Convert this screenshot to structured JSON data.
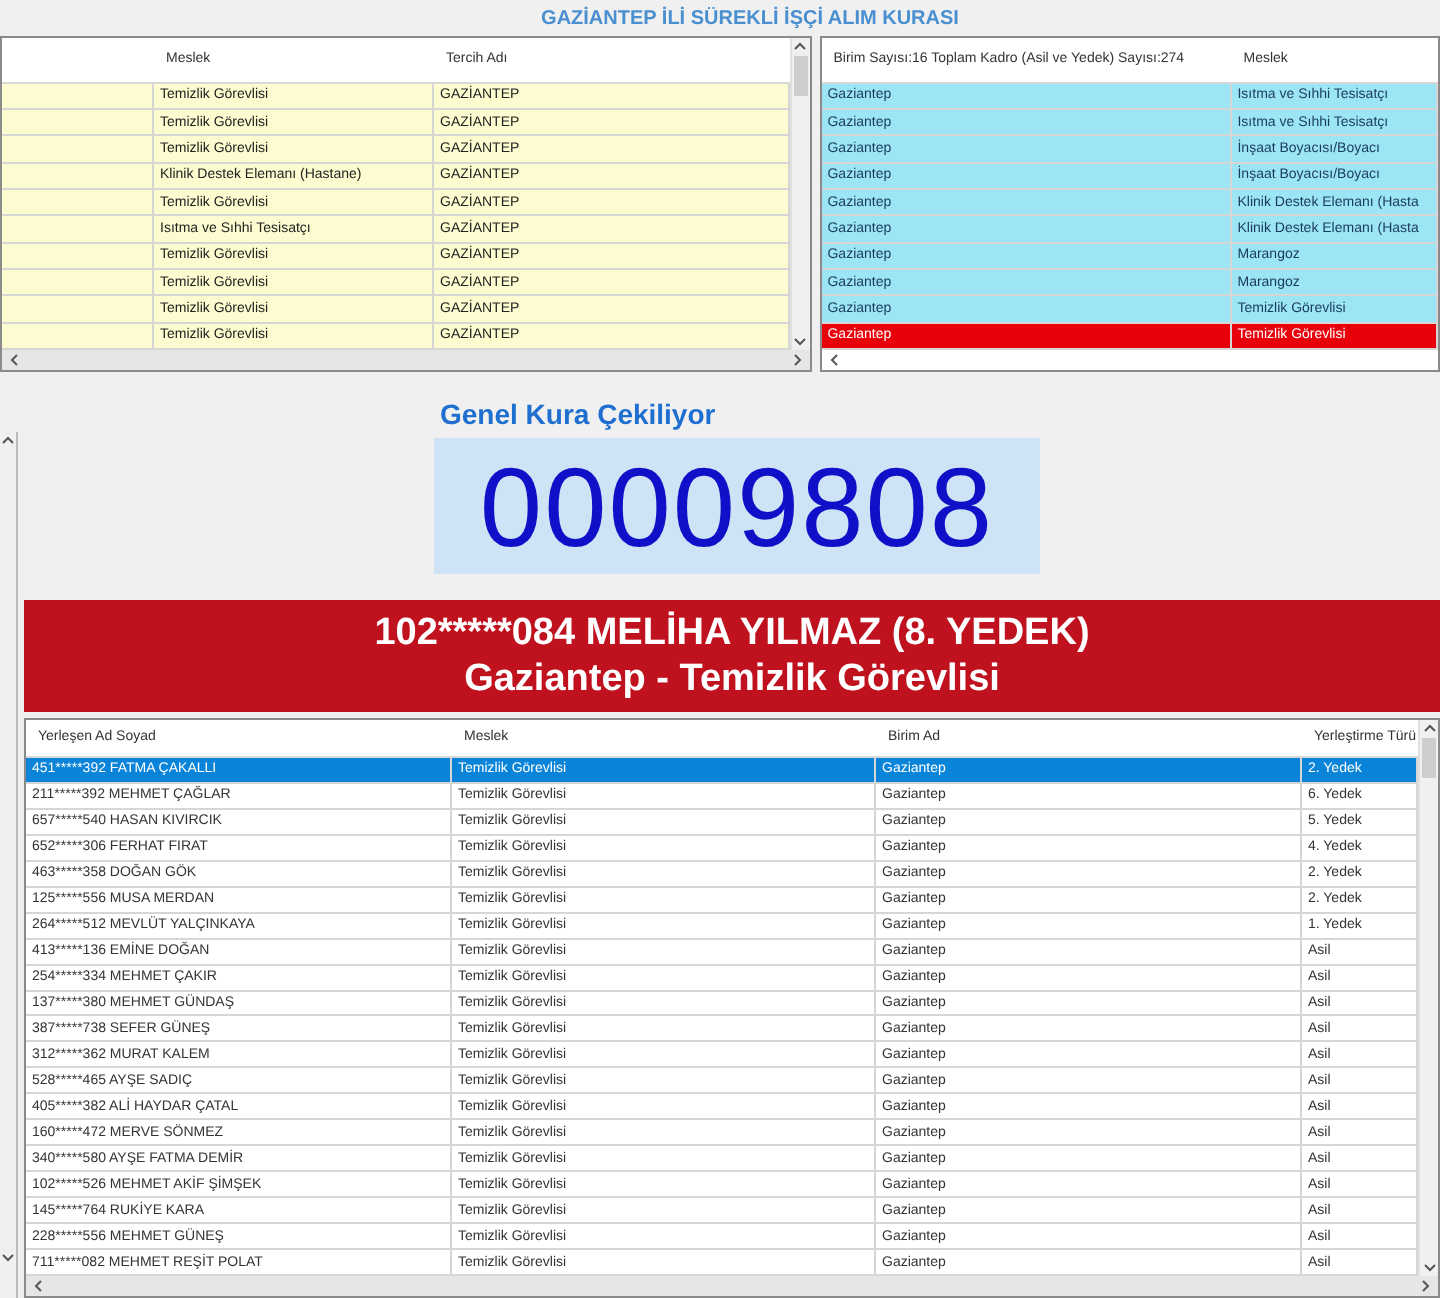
{
  "title": "GAZİANTEP İLİ SÜREKLİ İŞÇİ ALIM KURASI",
  "preferences_table": {
    "columns": [
      "Meslek",
      "Tercih Adı"
    ],
    "rows": [
      {
        "cells": [
          "Temizlik Görevlisi",
          "GAZİANTEP"
        ]
      },
      {
        "cells": [
          "Temizlik Görevlisi",
          "GAZİANTEP"
        ]
      },
      {
        "cells": [
          "Temizlik Görevlisi",
          "GAZİANTEP"
        ]
      },
      {
        "cells": [
          "Klinik Destek Elemanı (Hastane)",
          "GAZİANTEP"
        ]
      },
      {
        "cells": [
          "Temizlik Görevlisi",
          "GAZİANTEP"
        ]
      },
      {
        "cells": [
          "Isıtma ve Sıhhi Tesisatçı",
          "GAZİANTEP"
        ]
      },
      {
        "cells": [
          "Temizlik Görevlisi",
          "GAZİANTEP"
        ]
      },
      {
        "cells": [
          "Temizlik Görevlisi",
          "GAZİANTEP"
        ]
      },
      {
        "cells": [
          "Temizlik Görevlisi",
          "GAZİANTEP"
        ]
      },
      {
        "cells": [
          "Temizlik Görevlisi",
          "GAZİANTEP"
        ]
      }
    ]
  },
  "units_table": {
    "columns": [
      "Birim Sayısı:16 Toplam Kadro (Asil ve Yedek) Sayısı:274",
      "Meslek"
    ],
    "rows": [
      {
        "cells": [
          "Gaziantep",
          "Isıtma ve Sıhhi Tesisatçı"
        ],
        "highlighted": false
      },
      {
        "cells": [
          "Gaziantep",
          "Isıtma ve Sıhhi Tesisatçı"
        ],
        "highlighted": false
      },
      {
        "cells": [
          "Gaziantep",
          "İnşaat Boyacısı/Boyacı"
        ],
        "highlighted": false
      },
      {
        "cells": [
          "Gaziantep",
          "İnşaat Boyacısı/Boyacı"
        ],
        "highlighted": false
      },
      {
        "cells": [
          "Gaziantep",
          "Klinik Destek Elemanı (Hasta"
        ],
        "highlighted": false
      },
      {
        "cells": [
          "Gaziantep",
          "Klinik Destek Elemanı (Hasta"
        ],
        "highlighted": false
      },
      {
        "cells": [
          "Gaziantep",
          "Marangoz"
        ],
        "highlighted": false
      },
      {
        "cells": [
          "Gaziantep",
          "Marangoz"
        ],
        "highlighted": false
      },
      {
        "cells": [
          "Gaziantep",
          "Temizlik Görevlisi"
        ],
        "highlighted": false
      },
      {
        "cells": [
          "Gaziantep",
          "Temizlik Görevlisi"
        ],
        "highlighted": true
      }
    ]
  },
  "draw": {
    "heading": "Genel Kura Çekiliyor",
    "number": "00009808"
  },
  "banner": {
    "line_1": "102*****084 MELİHA YILMAZ (8. YEDEK)",
    "line_2": "Gaziantep - Temizlik Görevlisi"
  },
  "results_table": {
    "columns": [
      "Yerleşen Ad Soyad",
      "Meslek",
      "Birim Ad",
      "Yerleştirme Türü"
    ],
    "rows": [
      {
        "cells": [
          "451*****392 FATMA ÇAKALLI",
          "Temizlik Görevlisi",
          "Gaziantep",
          "2. Yedek"
        ],
        "selected": true
      },
      {
        "cells": [
          "211*****392 MEHMET ÇAĞLAR",
          "Temizlik Görevlisi",
          "Gaziantep",
          "6. Yedek"
        ],
        "selected": false
      },
      {
        "cells": [
          "657*****540 HASAN KIVIRCIK",
          "Temizlik Görevlisi",
          "Gaziantep",
          "5. Yedek"
        ],
        "selected": false
      },
      {
        "cells": [
          "652*****306 FERHAT FIRAT",
          "Temizlik Görevlisi",
          "Gaziantep",
          "4. Yedek"
        ],
        "selected": false
      },
      {
        "cells": [
          "463*****358 DOĞAN GÖK",
          "Temizlik Görevlisi",
          "Gaziantep",
          "2. Yedek"
        ],
        "selected": false
      },
      {
        "cells": [
          "125*****556 MUSA MERDAN",
          "Temizlik Görevlisi",
          "Gaziantep",
          "2. Yedek"
        ],
        "selected": false
      },
      {
        "cells": [
          "264*****512 MEVLÜT YALÇINKAYA",
          "Temizlik Görevlisi",
          "Gaziantep",
          "1. Yedek"
        ],
        "selected": false
      },
      {
        "cells": [
          "413*****136 EMİNE DOĞAN",
          "Temizlik Görevlisi",
          "Gaziantep",
          "Asil"
        ],
        "selected": false
      },
      {
        "cells": [
          "254*****334 MEHMET ÇAKIR",
          "Temizlik Görevlisi",
          "Gaziantep",
          "Asil"
        ],
        "selected": false
      },
      {
        "cells": [
          "137*****380 MEHMET GÜNDAŞ",
          "Temizlik Görevlisi",
          "Gaziantep",
          "Asil"
        ],
        "selected": false
      },
      {
        "cells": [
          "387*****738 SEFER GÜNEŞ",
          "Temizlik Görevlisi",
          "Gaziantep",
          "Asil"
        ],
        "selected": false
      },
      {
        "cells": [
          "312*****362 MURAT KALEM",
          "Temizlik Görevlisi",
          "Gaziantep",
          "Asil"
        ],
        "selected": false
      },
      {
        "cells": [
          "528*****465 AYŞE SADIÇ",
          "Temizlik Görevlisi",
          "Gaziantep",
          "Asil"
        ],
        "selected": false
      },
      {
        "cells": [
          "405*****382 ALİ HAYDAR ÇATAL",
          "Temizlik Görevlisi",
          "Gaziantep",
          "Asil"
        ],
        "selected": false
      },
      {
        "cells": [
          "160*****472 MERVE SÖNMEZ",
          "Temizlik Görevlisi",
          "Gaziantep",
          "Asil"
        ],
        "selected": false
      },
      {
        "cells": [
          "340*****580 AYŞE FATMA DEMİR",
          "Temizlik Görevlisi",
          "Gaziantep",
          "Asil"
        ],
        "selected": false
      },
      {
        "cells": [
          "102*****526 MEHMET AKİF ŞİMŞEK",
          "Temizlik Görevlisi",
          "Gaziantep",
          "Asil"
        ],
        "selected": false
      },
      {
        "cells": [
          "145*****764 RUKİYE KARA",
          "Temizlik Görevlisi",
          "Gaziantep",
          "Asil"
        ],
        "selected": false
      },
      {
        "cells": [
          "228*****556 MEHMET GÜNEŞ",
          "Temizlik Görevlisi",
          "Gaziantep",
          "Asil"
        ],
        "selected": false
      },
      {
        "cells": [
          "711*****082 MEHMET REŞİT POLAT",
          "Temizlik Görevlisi",
          "Gaziantep",
          "Asil"
        ],
        "selected": false
      }
    ]
  }
}
